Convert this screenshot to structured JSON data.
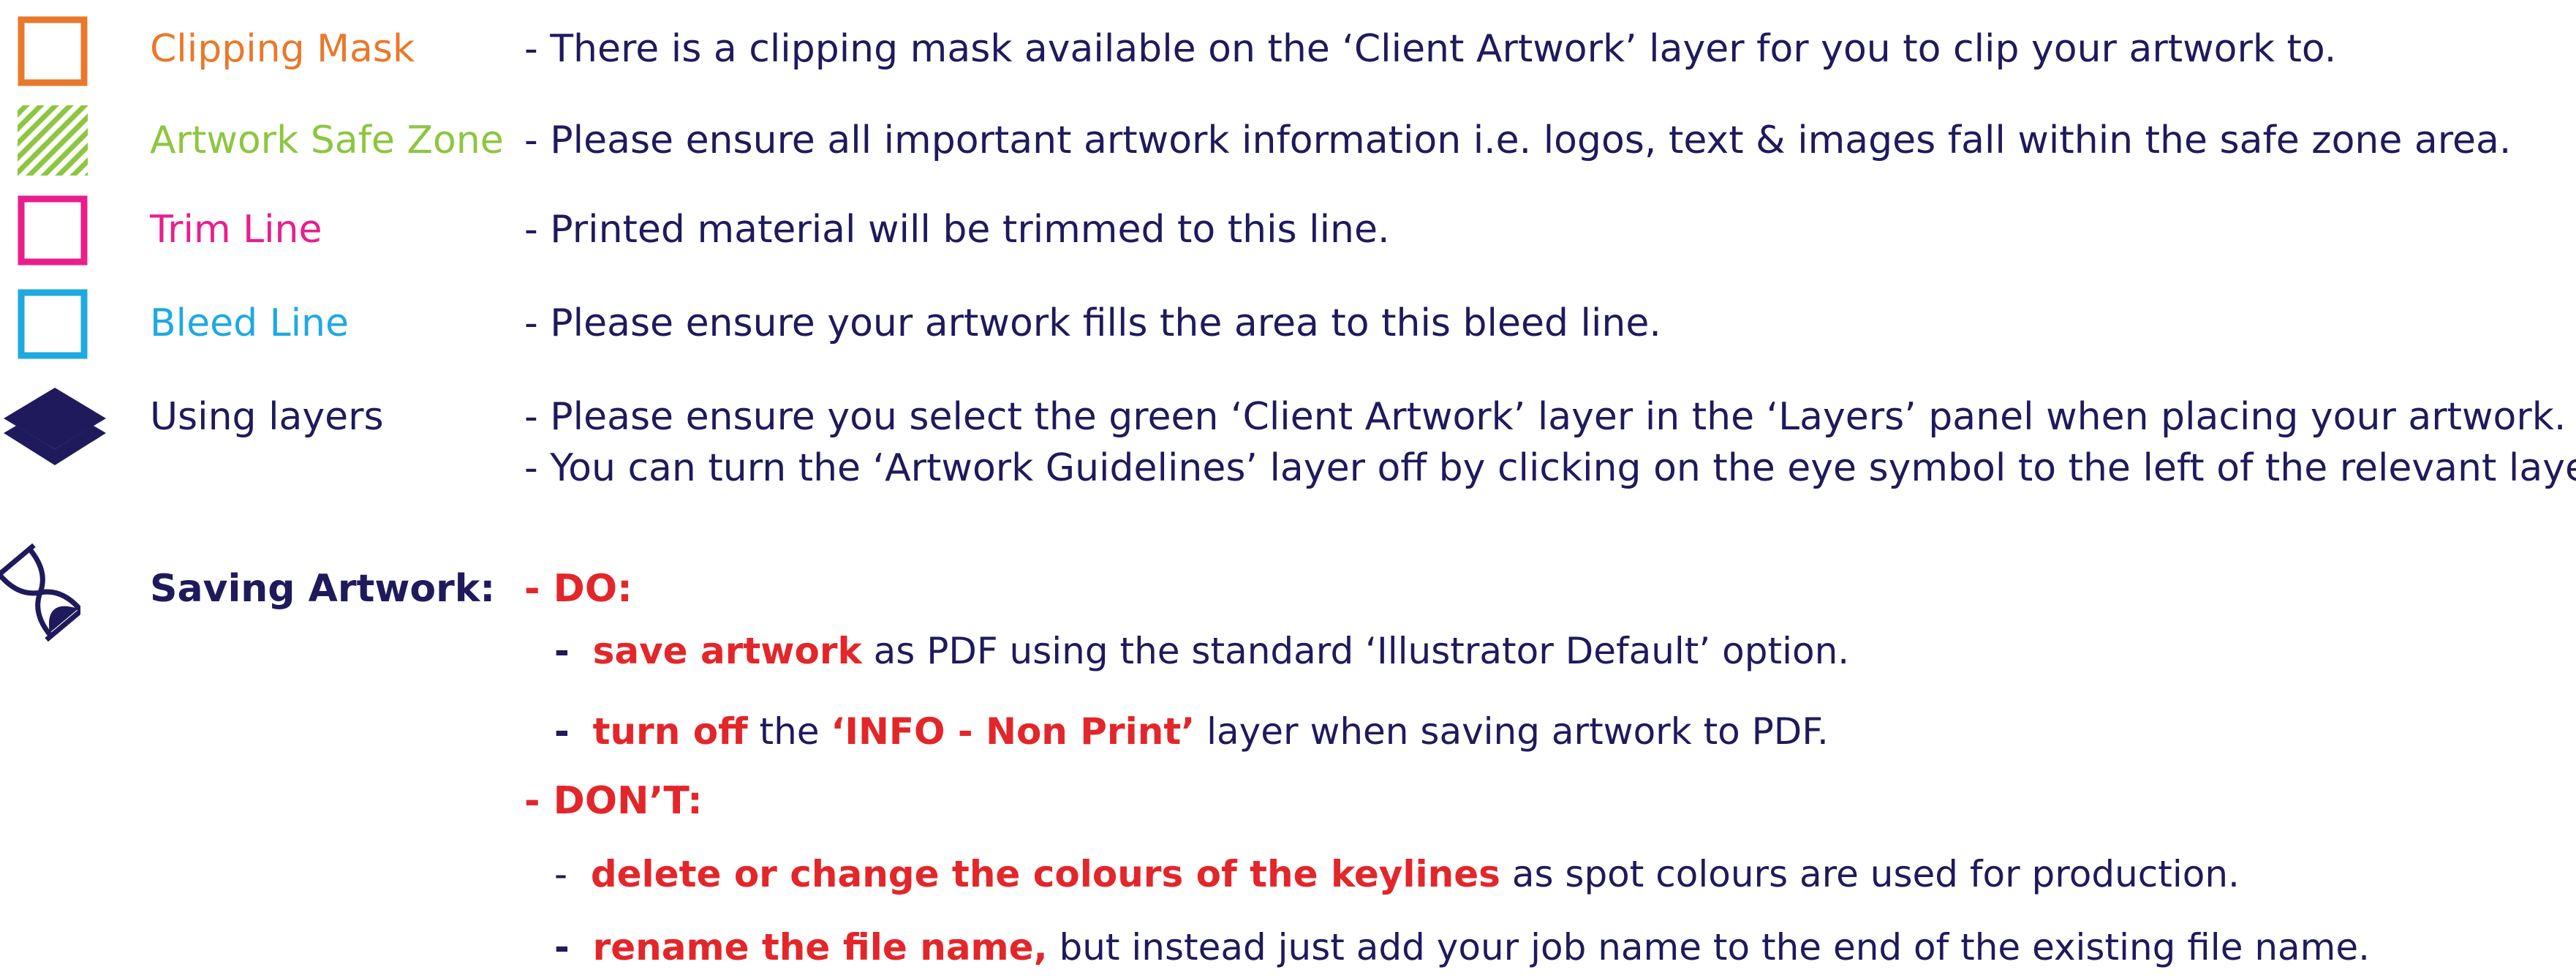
{
  "colors": {
    "navy": "#1f1a5c",
    "orange": "#e8792b",
    "green": "#8dc63f",
    "magenta": "#e91e8c",
    "cyan": "#1fa9e1",
    "red": "#e3262a"
  },
  "legend": [
    {
      "icon": "orange-square-icon",
      "label": "Clipping Mask",
      "description": "- There is a clipping mask available on the ‘Client Artwork’ layer for you to clip your artwork to."
    },
    {
      "icon": "green-hatched-square-icon",
      "label": "Artwork Safe Zone",
      "description": "-  Please ensure all important artwork information i.e. logos, text & images fall within the safe zone area."
    },
    {
      "icon": "magenta-square-icon",
      "label": "Trim Line",
      "description": "-  Printed material will be trimmed to this line."
    },
    {
      "icon": "cyan-square-icon",
      "label": "Bleed Line",
      "description": "-  Please ensure your artwork fills the area to this bleed line."
    },
    {
      "icon": "layers-icon",
      "label": "Using layers",
      "description": "-  Please ensure you select the green ‘Client Artwork’ layer in the ‘Layers’ panel when placing your artwork.",
      "description2": "-  You can turn the ‘Artwork Guidelines’  layer off by clicking on the eye symbol to the left of the relevant layer."
    }
  ],
  "saving": {
    "icon": "hourglass-icon",
    "label": "Saving Artwork:",
    "do_heading": "-  DO:",
    "do_items": [
      {
        "dash": "-",
        "emph": "save artwork",
        "text": " as PDF using the standard ‘Illustrator Default’ option."
      },
      {
        "dash": "-",
        "emph": "turn off",
        "text": " the ",
        "emph2": "‘INFO - Non Print’",
        "text2": " layer when saving artwork to PDF."
      }
    ],
    "dont_heading": "-  DON’T:",
    "dont_items": [
      {
        "dash": "-",
        "emph": "delete or change the colours of the keylines",
        "text": " as spot colours are used for production."
      },
      {
        "dash": "-",
        "emph": "rename the file name,",
        "text": " but instead just add your job name to the end of the existing file name."
      }
    ]
  }
}
